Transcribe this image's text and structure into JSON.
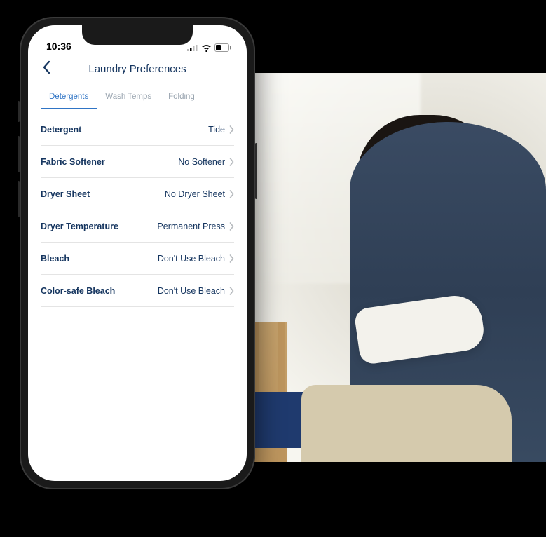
{
  "status_bar": {
    "time": "10:36"
  },
  "header": {
    "title": "Laundry Preferences"
  },
  "tabs": [
    {
      "label": "Detergents",
      "active": true
    },
    {
      "label": "Wash Temps",
      "active": false
    },
    {
      "label": "Folding",
      "active": false
    }
  ],
  "settings": [
    {
      "label": "Detergent",
      "value": "Tide"
    },
    {
      "label": "Fabric Softener",
      "value": "No Softener"
    },
    {
      "label": "Dryer Sheet",
      "value": "No Dryer Sheet"
    },
    {
      "label": "Dryer Temperature",
      "value": "Permanent Press"
    },
    {
      "label": "Bleach",
      "value": "Don't Use Bleach"
    },
    {
      "label": "Color-safe Bleach",
      "value": "Don't Use Bleach"
    }
  ],
  "background_image": {
    "description": "Woman in denim shirt folding laundry at a table, pile of clothes, bright room with window"
  },
  "colors": {
    "primary": "#15355f",
    "tab_active": "#2f74c5",
    "tab_inactive": "#9aa5b0",
    "divider": "#e4e4e4"
  }
}
